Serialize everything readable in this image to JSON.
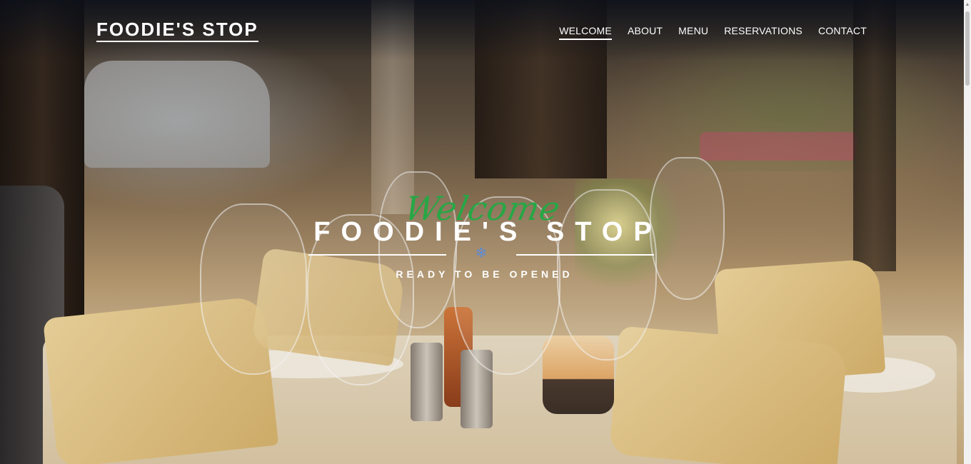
{
  "header": {
    "logo": "FOODIE'S STOP",
    "nav": [
      {
        "label": "WELCOME",
        "active": true
      },
      {
        "label": "ABOUT",
        "active": false
      },
      {
        "label": "MENU",
        "active": false
      },
      {
        "label": "RESERVATIONS",
        "active": false
      },
      {
        "label": "CONTACT",
        "active": false
      }
    ]
  },
  "hero": {
    "script_heading": "Welcome",
    "title": "FOODIE'S STOP",
    "divider_icon": "snowflake-icon",
    "tagline": "READY TO BE OPENED"
  },
  "colors": {
    "accent_green": "#27a745",
    "icon_blue": "#5e8bd6",
    "text": "#ffffff"
  }
}
